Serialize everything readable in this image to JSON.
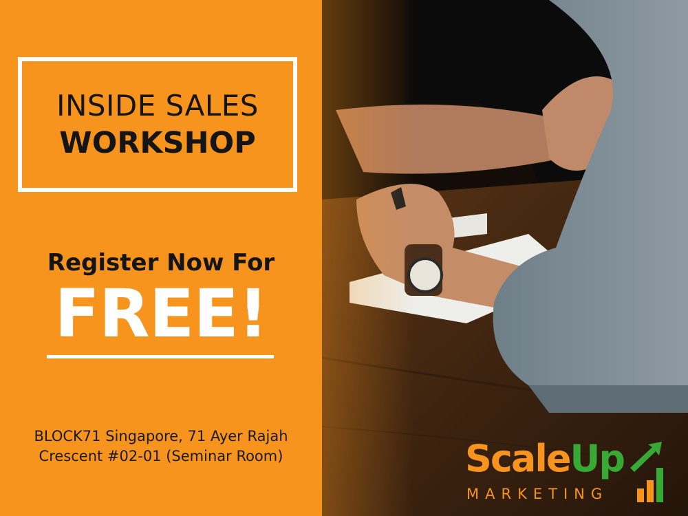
{
  "headline": {
    "line1": "INSIDE SALES",
    "line2": "WORKSHOP"
  },
  "cta": {
    "register": "Register Now For",
    "free": "FREE!"
  },
  "address": {
    "line1": "BLOCK71 Singapore, 71 Ayer Rajah",
    "line2": "Crescent #02-01 (Seminar Room)"
  },
  "logo": {
    "scale": "Scale",
    "up": "Up",
    "sub": "MARKETING"
  },
  "colors": {
    "accent": "#f7941d",
    "logo_green": "#39a935",
    "text_dark": "#151515",
    "white": "#ffffff"
  },
  "photo": {
    "icon": "photo-people-meeting"
  }
}
